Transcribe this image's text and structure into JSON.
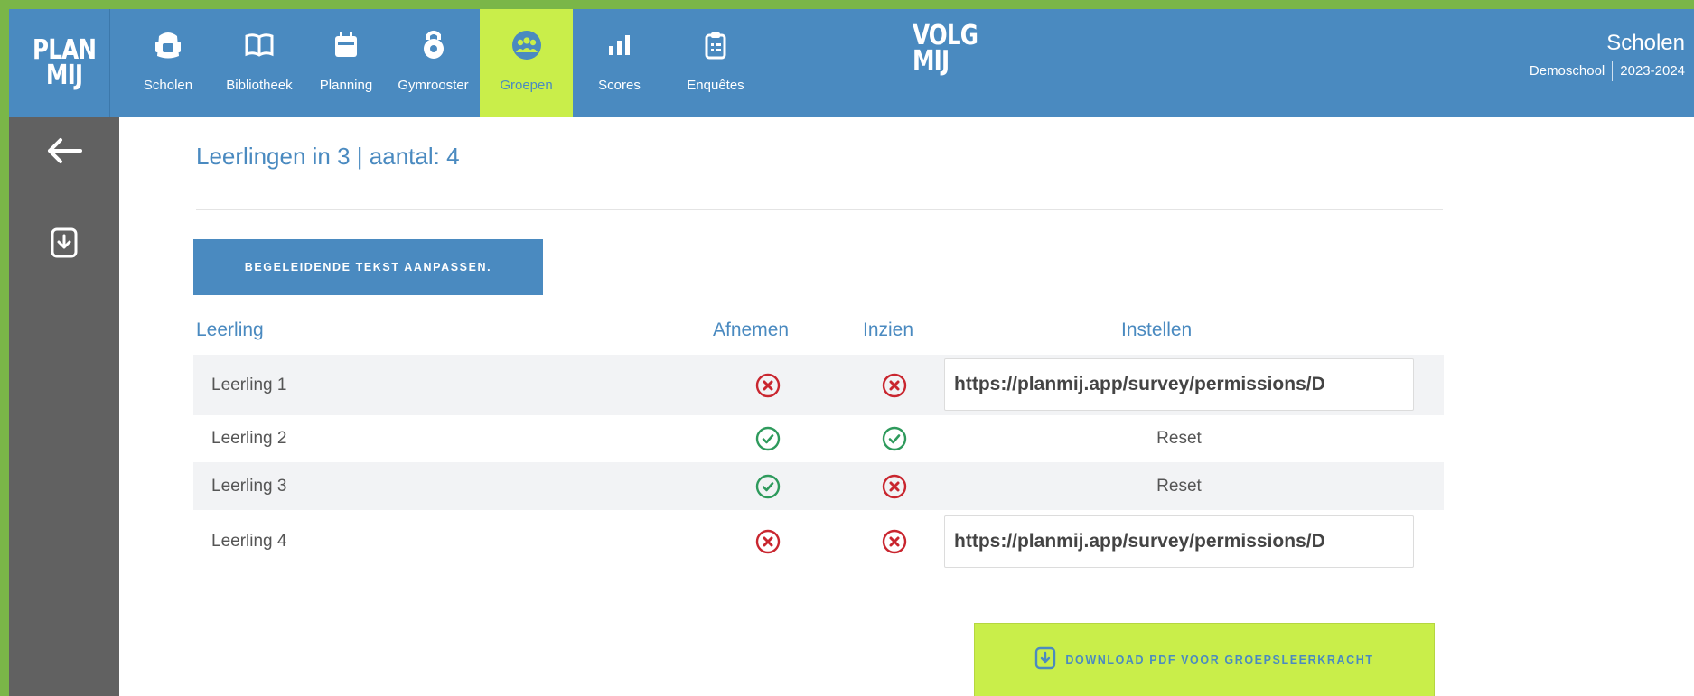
{
  "brand": {
    "line1": "PLAN",
    "line2": "MIJ"
  },
  "brand2": {
    "line1": "VOLG",
    "line2": "MIJ"
  },
  "nav": {
    "items": [
      {
        "label": "Scholen",
        "icon": "backpack-icon"
      },
      {
        "label": "Bibliotheek",
        "icon": "book-icon"
      },
      {
        "label": "Planning",
        "icon": "calendar-icon"
      },
      {
        "label": "Gymrooster",
        "icon": "kettlebell-icon"
      },
      {
        "label": "Groepen",
        "icon": "group-icon",
        "active": true
      },
      {
        "label": "Scores",
        "icon": "bar-chart-icon"
      },
      {
        "label": "Enquêtes",
        "icon": "clipboard-icon"
      }
    ]
  },
  "school": {
    "title": "Scholen",
    "name": "Demoschool",
    "year": "2023-2024"
  },
  "sidebar": {
    "items": [
      {
        "icon": "arrow-left-icon"
      },
      {
        "icon": "file-download-icon"
      }
    ]
  },
  "main": {
    "title": "Leerlingen in 3 | aantal: 4",
    "edit_button": "BEGELEIDENDE TEKST AANPASSEN.",
    "columns": {
      "student": "Leerling",
      "take": "Afnemen",
      "view": "Inzien",
      "settings": "Instellen"
    },
    "rows": [
      {
        "name": "Leerling 1",
        "take": "no",
        "view": "no",
        "settings_type": "url",
        "settings": "https://planmij.app/survey/permissions/D"
      },
      {
        "name": "Leerling 2",
        "take": "yes",
        "view": "yes",
        "settings_type": "reset",
        "settings": "Reset"
      },
      {
        "name": "Leerling 3",
        "take": "yes",
        "view": "no",
        "settings_type": "reset",
        "settings": "Reset"
      },
      {
        "name": "Leerling 4",
        "take": "no",
        "view": "no",
        "settings_type": "url",
        "settings": "https://planmij.app/survey/permissions/D"
      }
    ],
    "pdf_button": "DOWNLOAD PDF VOOR GROEPSLEERKRACHT"
  },
  "colors": {
    "blue": "#4a8ac0",
    "lime": "#c9ee4a",
    "sidebar": "#616161",
    "frame_green": "#7ab648",
    "yes": "#2e9a5c",
    "no": "#c9262f"
  }
}
